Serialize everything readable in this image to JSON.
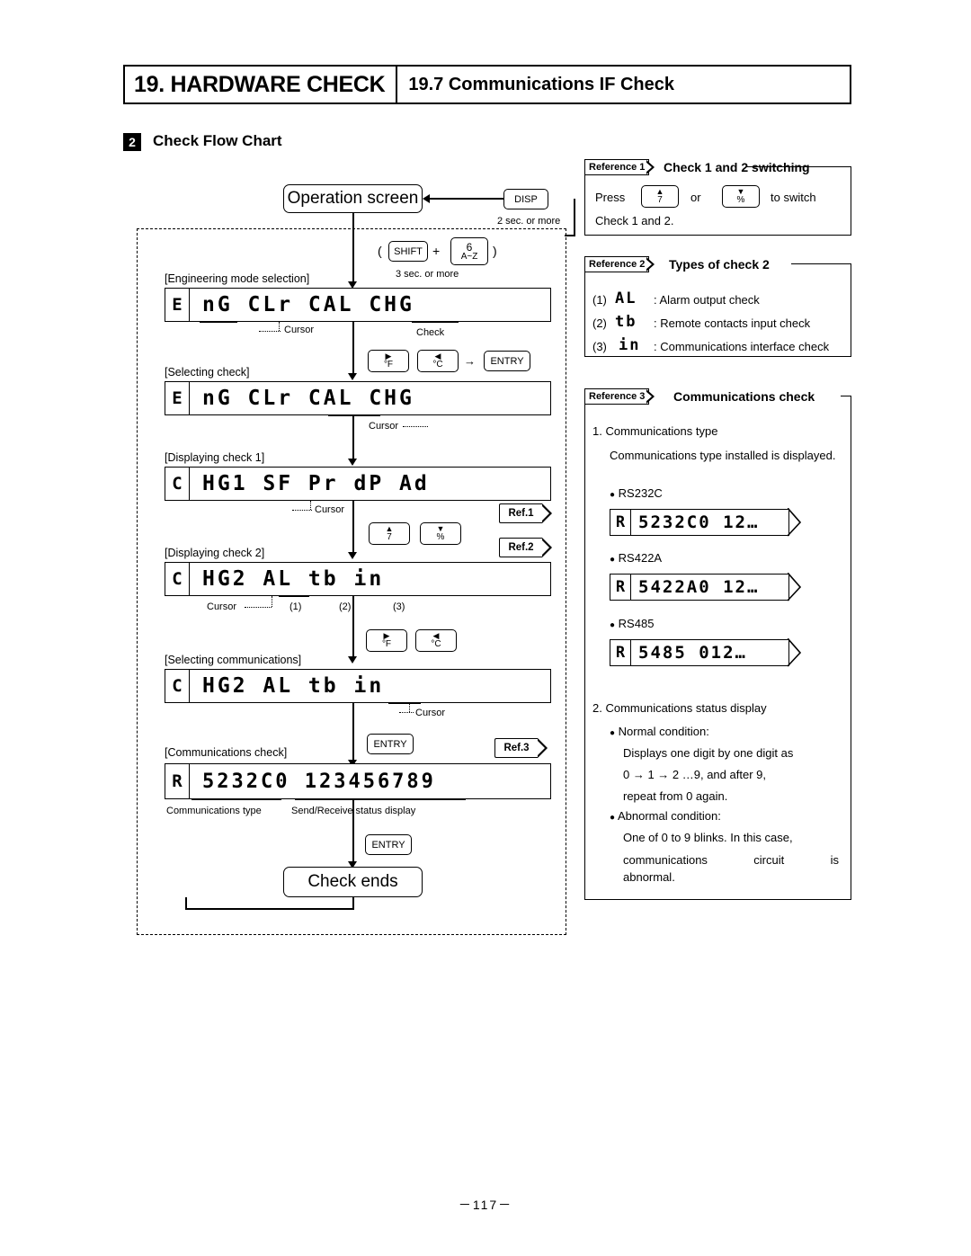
{
  "header": {
    "chapter": "19. HARDWARE CHECK",
    "section": "19.7 Communications IF Check"
  },
  "section": {
    "number": "2",
    "title": "Check Flow Chart"
  },
  "flow": {
    "operation_screen": "Operation screen",
    "disp_key": "DISP",
    "disp_note": "2 sec. or more",
    "shift_key": "SHIFT",
    "plus": "+",
    "six_key_top": "6",
    "six_key_bottom": "A~Z",
    "paren_open": "(",
    "paren_close": ")",
    "shift_note": "3 sec. or more",
    "label_eng_mode": "[Engineering mode selection]",
    "label_selecting_check": "[Selecting check]",
    "label_display_check1": "[Displaying check 1]",
    "label_display_check2": "[Displaying check 2]",
    "label_selecting_comm": "[Selecting communications]",
    "label_comm_check": "[Communications check]",
    "cursor": "Cursor",
    "check_label": "Check",
    "entry_key": "ENTRY",
    "key_f": "°F",
    "key_c": "°C",
    "arrow_to": "→",
    "num1": "(1)",
    "num2": "(2)",
    "num3": "(3)",
    "comm_type_label": "Communications type",
    "send_recv_label": "Send/Receive status display",
    "check_ends": "Check ends",
    "ref1": "Ref.1",
    "ref2": "Ref.2",
    "ref3": "Ref.3",
    "rows": [
      {
        "mini": "E",
        "seg": "nG  CLr  CAL  CHG"
      },
      {
        "mini": "E",
        "seg": "nG  CLr  CAL  CHG"
      },
      {
        "mini": "C",
        "seg": "HG1  SF  Pr  dP  Ad"
      },
      {
        "mini": "C",
        "seg": "HG2  AL  tb  in"
      },
      {
        "mini": "C",
        "seg": "HG2  AL  tb  in"
      },
      {
        "mini": "R",
        "seg": "5232C0 123456789"
      }
    ]
  },
  "reference1": {
    "tag": "Reference 1",
    "title": "Check 1 and 2 switching",
    "press": "Press",
    "key_up_top": "▲",
    "key_up_bottom": "7",
    "or": "or",
    "key_down_top": "▼",
    "key_down_bottom": "%",
    "to_switch": "to  switch",
    "line2": "Check 1 and 2."
  },
  "reference2": {
    "tag": "Reference 2",
    "title": "Types of check 2",
    "items": [
      {
        "num": "(1)",
        "code": "AL",
        "desc": ": Alarm output check"
      },
      {
        "num": "(2)",
        "code": "tb",
        "desc": ": Remote contacts input check"
      },
      {
        "num": "(3)",
        "code": "in",
        "desc": ": Communications interface check"
      }
    ]
  },
  "reference3": {
    "tag": "Reference 3",
    "title": "Communications check",
    "item1_head": "1. Communications type",
    "item1_body": "Communications type installed is displayed.",
    "rs232c_label": "RS232C",
    "rs422a_label": "RS422A",
    "rs485_label": "RS485",
    "rs232c_mini": "R",
    "rs232c_seg": "5232C0 12…",
    "rs422a_mini": "R",
    "rs422a_seg": "5422A0 12…",
    "rs485_mini": "R",
    "rs485_seg": "5485  012…",
    "item2_head": "2. Communications status display",
    "normal_label": "Normal condition:",
    "normal_body1": "Displays one digit by one digit as",
    "normal_body2": "0 → 1 → 2 …9, and after 9,",
    "normal_body3": "repeat from 0 again.",
    "abnormal_label": "Abnormal condition:",
    "abnormal_body1": "One of 0 to 9 blinks. In this case,",
    "abnormal_body2": "communications circuit is",
    "abnormal_body3": "abnormal."
  },
  "footer": {
    "page": "－117－"
  }
}
